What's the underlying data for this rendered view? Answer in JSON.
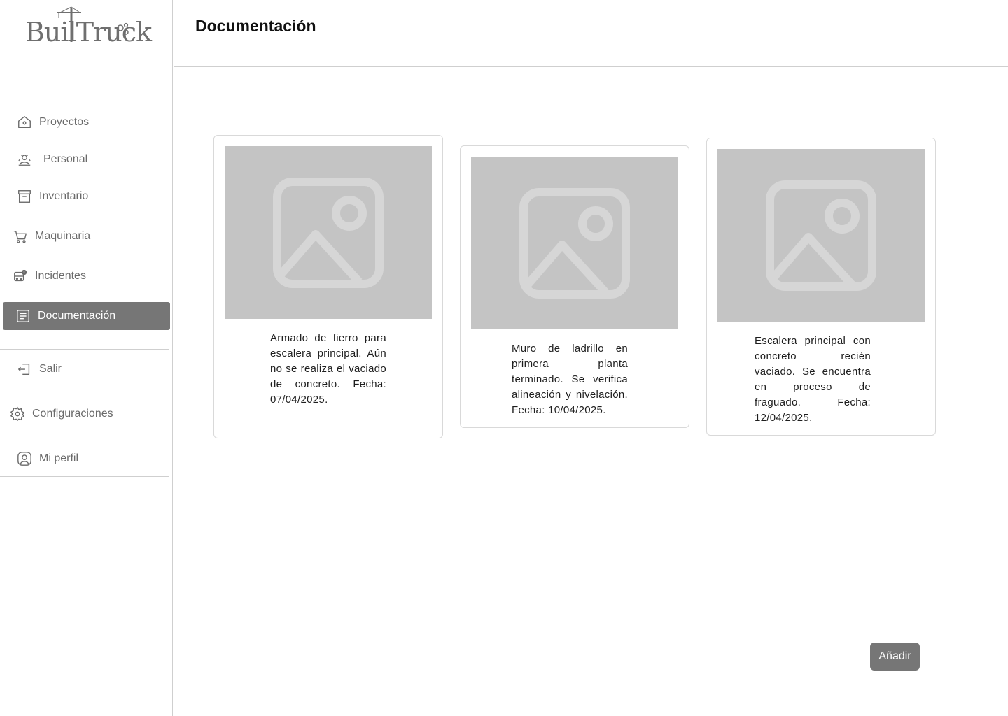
{
  "app": {
    "logo_text": "BuilTruck"
  },
  "header": {
    "title": "Documentación"
  },
  "sidebar": {
    "items": [
      {
        "label": "Proyectos",
        "icon": "home-icon"
      },
      {
        "label": "Personal",
        "icon": "people-icon"
      },
      {
        "label": "Inventario",
        "icon": "archive-icon"
      },
      {
        "label": "Maquinaria",
        "icon": "cart-icon"
      },
      {
        "label": "Incidentes",
        "icon": "alert-bus-icon"
      },
      {
        "label": "Documentación",
        "icon": "document-icon",
        "active": true
      }
    ],
    "footer_items": [
      {
        "label": "Salir",
        "icon": "logout-icon"
      },
      {
        "label": "Configuraciones",
        "icon": "gear-icon"
      },
      {
        "label": "Mi perfil",
        "icon": "user-icon"
      }
    ]
  },
  "documents": [
    {
      "description": "Armado de fierro para escalera principal. Aún no se realiza el vaciado de concreto. Fecha: 07/04/2025.",
      "image": "image-placeholder-icon"
    },
    {
      "description": "Muro de ladrillo en primera planta terminado. Se verifica alineación y nivelación. Fecha: 10/04/2025.",
      "image": "image-placeholder-icon"
    },
    {
      "description": "Escalera principal con concreto recién vaciado. Se encuentra en proceso de fraguado. Fecha: 12/04/2025.",
      "image": "image-placeholder-icon"
    }
  ],
  "actions": {
    "add_label": "Añadir"
  },
  "colors": {
    "active_bg": "#767676",
    "placeholder_bg": "#c4c4c4",
    "button_bg": "#767676"
  }
}
